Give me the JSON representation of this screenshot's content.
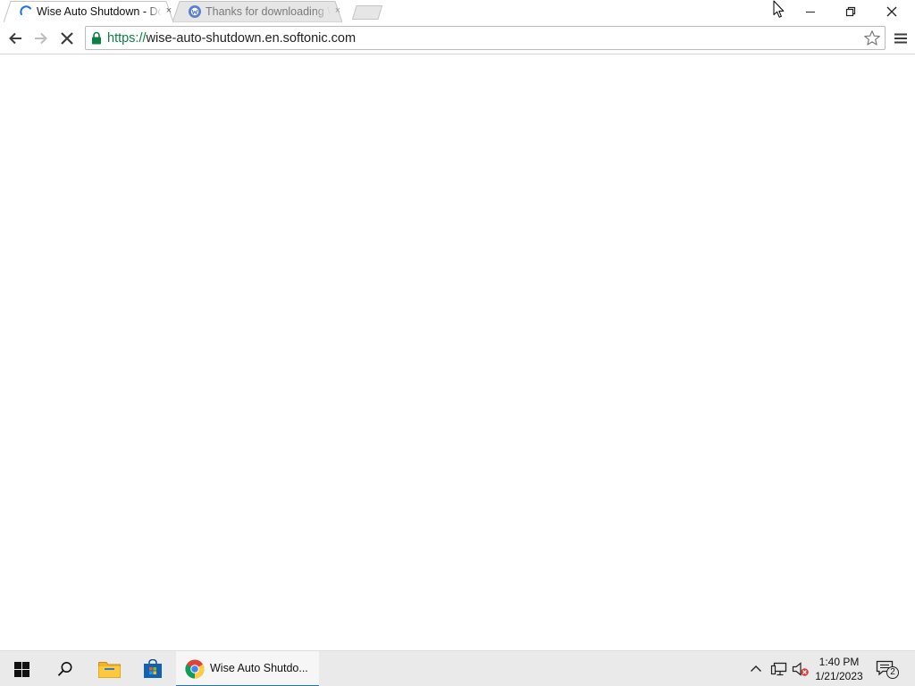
{
  "browser": {
    "tabs": [
      {
        "title": "Wise Auto Shutdown - Download",
        "active": true,
        "loading": true,
        "favicon": "loading-spinner-icon"
      },
      {
        "title": "Thanks for downloading Wise Auto Shutdown",
        "active": false,
        "loading": false,
        "favicon": "softonic-icon"
      }
    ],
    "close_tab_glyph": "×",
    "address_bar": {
      "scheme": "https://",
      "host": "wise-auto-shutdown.en.softonic.com",
      "secure": true
    },
    "icons": {
      "back": "arrow-left-icon",
      "forward": "arrow-right-icon",
      "stop": "stop-loading-icon",
      "lock": "lock-icon",
      "bookmark": "star-outline-icon",
      "menu": "hamburger-menu-icon"
    },
    "colors": {
      "secure_scheme": "#0b8043",
      "spinner": "#1a73e8",
      "lock": "#0b8043"
    }
  },
  "taskbar": {
    "chrome_button_label": "Wise Auto Shutdo...",
    "clock": {
      "time": "1:40 PM",
      "date": "1/21/2023"
    },
    "notification_count": "2",
    "accent_color": "#1f6fd0"
  }
}
